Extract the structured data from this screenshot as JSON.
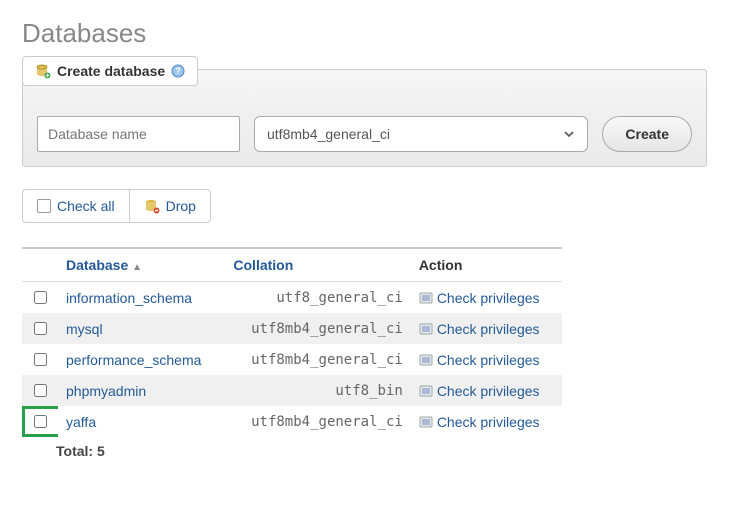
{
  "page_title": "Databases",
  "create": {
    "tab_label": "Create database",
    "name_placeholder": "Database name",
    "collation_value": "utf8mb4_general_ci",
    "button_label": "Create"
  },
  "toolbar": {
    "check_all": "Check all",
    "drop": "Drop"
  },
  "table": {
    "headers": {
      "database": "Database",
      "collation": "Collation",
      "action": "Action"
    },
    "priv_label": "Check privileges",
    "rows": [
      {
        "name": "information_schema",
        "collation": "utf8_general_ci",
        "highlight": false
      },
      {
        "name": "mysql",
        "collation": "utf8mb4_general_ci",
        "highlight": false
      },
      {
        "name": "performance_schema",
        "collation": "utf8mb4_general_ci",
        "highlight": false
      },
      {
        "name": "phpmyadmin",
        "collation": "utf8_bin",
        "highlight": false
      },
      {
        "name": "yaffa",
        "collation": "utf8mb4_general_ci",
        "highlight": true
      }
    ],
    "total_label": "Total: 5"
  }
}
